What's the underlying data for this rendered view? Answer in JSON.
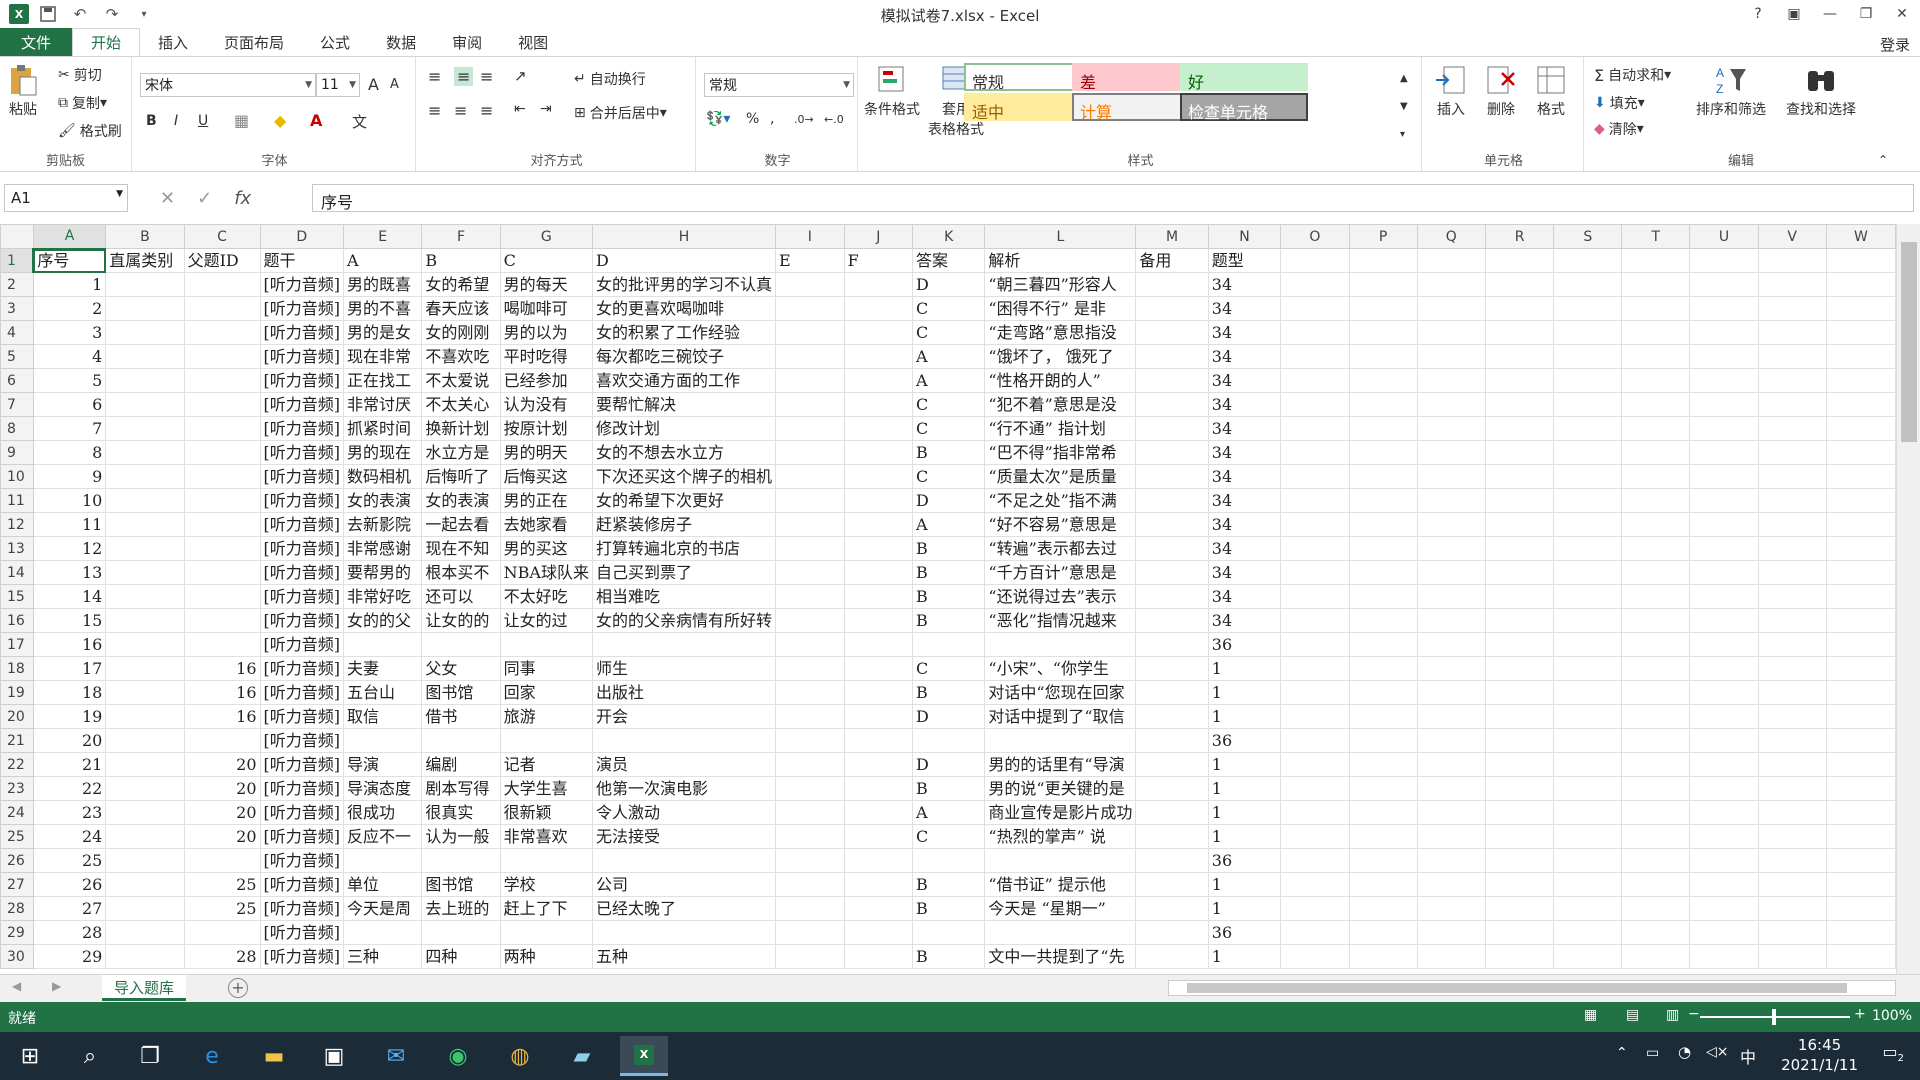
{
  "window": {
    "title": "模拟试卷7.xlsx - Excel",
    "help": "?",
    "login": "登录"
  },
  "tabs": [
    "文件",
    "开始",
    "插入",
    "页面布局",
    "公式",
    "数据",
    "审阅",
    "视图"
  ],
  "ribbon": {
    "clipboard": {
      "paste": "粘贴",
      "cut": "剪切",
      "copy": "复制",
      "format_painter": "格式刷",
      "label": "剪贴板"
    },
    "font": {
      "name": "宋体",
      "size": "11",
      "label": "字体",
      "grow": "A",
      "shrink": "A",
      "bold": "B",
      "italic": "I",
      "underline": "U"
    },
    "align": {
      "wrap": "自动换行",
      "merge": "合并后居中",
      "label": "对齐方式"
    },
    "number": {
      "format": "常规",
      "percent": "%",
      "comma": ",",
      "label": "数字"
    },
    "styles": {
      "cond": "条件格式",
      "table": "套用",
      "table2": "表格格式",
      "label": "样式",
      "cells": [
        {
          "text": "常规",
          "bg": "#ffffff",
          "fg": "#333333",
          "border": "#8cc08c"
        },
        {
          "text": "差",
          "bg": "#ffc7ce",
          "fg": "#9c0006",
          "border": "#ffc7ce"
        },
        {
          "text": "好",
          "bg": "#c6efce",
          "fg": "#006100",
          "border": "#c6efce"
        },
        {
          "text": "适中",
          "bg": "#ffeb9c",
          "fg": "#9c5700",
          "border": "#ffeb9c"
        },
        {
          "text": "计算",
          "bg": "#f2f2f2",
          "fg": "#fa7d00",
          "border": "#7f7f7f"
        },
        {
          "text": "检查单元格",
          "bg": "#a5a5a5",
          "fg": "#ffffff",
          "border": "#3f3f3f"
        }
      ]
    },
    "cells": {
      "insert": "插入",
      "delete": "删除",
      "format": "格式",
      "label": "单元格"
    },
    "edit": {
      "autosum": "自动求和",
      "fill": "填充",
      "clear": "清除",
      "sort": "排序和筛选",
      "find": "查找和选择",
      "label": "编辑"
    }
  },
  "formula_bar": {
    "name_box": "A1",
    "fx": "fx",
    "content": "序号"
  },
  "columns": [
    "A",
    "B",
    "C",
    "D",
    "E",
    "F",
    "G",
    "H",
    "I",
    "J",
    "K",
    "L",
    "M",
    "N",
    "O",
    "P",
    "Q",
    "R",
    "S",
    "T",
    "U",
    "V",
    "W"
  ],
  "rows": [
    [
      "序号",
      "直属类别",
      "父题ID",
      "题干",
      "A",
      "B",
      "C",
      "D",
      "E",
      "F",
      "答案",
      "解析",
      "备用",
      "题型"
    ],
    [
      "1",
      "",
      "",
      "[听力音频]",
      "男的既喜",
      "女的希望",
      "男的每天",
      "女的批评男的学习不认真",
      "",
      "",
      "D",
      "“朝三暮四”形容人",
      "",
      "34"
    ],
    [
      "2",
      "",
      "",
      "[听力音频]",
      "男的不喜",
      "春天应该",
      "喝咖啡可",
      "女的更喜欢喝咖啡",
      "",
      "",
      "C",
      "“困得不行” 是非",
      "",
      "34"
    ],
    [
      "3",
      "",
      "",
      "[听力音频]",
      "男的是女",
      "女的刚刚",
      "男的以为",
      "女的积累了工作经验",
      "",
      "",
      "C",
      "“走弯路”意思指没",
      "",
      "34"
    ],
    [
      "4",
      "",
      "",
      "[听力音频]",
      "现在非常",
      "不喜欢吃",
      "平时吃得",
      "每次都吃三碗饺子",
      "",
      "",
      "A",
      "“饿坏了， 饿死了",
      "",
      "34"
    ],
    [
      "5",
      "",
      "",
      "[听力音频]",
      "正在找工",
      "不太爱说",
      "已经参加",
      "喜欢交通方面的工作",
      "",
      "",
      "A",
      "“性格开朗的人”",
      "",
      "34"
    ],
    [
      "6",
      "",
      "",
      "[听力音频]",
      "非常讨厌",
      "不太关心",
      "认为没有",
      "要帮忙解决",
      "",
      "",
      "C",
      "“犯不着”意思是没",
      "",
      "34"
    ],
    [
      "7",
      "",
      "",
      "[听力音频]",
      "抓紧时间",
      "换新计划",
      "按原计划",
      "修改计划",
      "",
      "",
      "C",
      "“行不通” 指计划",
      "",
      "34"
    ],
    [
      "8",
      "",
      "",
      "[听力音频]",
      "男的现在",
      "水立方是",
      "男的明天",
      "女的不想去水立方",
      "",
      "",
      "B",
      "“巴不得”指非常希",
      "",
      "34"
    ],
    [
      "9",
      "",
      "",
      "[听力音频]",
      "数码相机",
      "后悔听了",
      "后悔买这",
      "下次还买这个牌子的相机",
      "",
      "",
      "C",
      "“质量太次”是质量",
      "",
      "34"
    ],
    [
      "10",
      "",
      "",
      "[听力音频]",
      "女的表演",
      "女的表演",
      "男的正在",
      "女的希望下次更好",
      "",
      "",
      "D",
      "“不足之处”指不满",
      "",
      "34"
    ],
    [
      "11",
      "",
      "",
      "[听力音频]",
      "去新影院",
      "一起去看",
      "去她家看",
      "赶紧装修房子",
      "",
      "",
      "A",
      "“好不容易”意思是",
      "",
      "34"
    ],
    [
      "12",
      "",
      "",
      "[听力音频]",
      "非常感谢",
      "现在不知",
      "男的买这",
      "打算转遍北京的书店",
      "",
      "",
      "B",
      "“转遍”表示都去过",
      "",
      "34"
    ],
    [
      "13",
      "",
      "",
      "[听力音频]",
      "要帮男的",
      "根本买不",
      "NBA球队来",
      "自己买到票了",
      "",
      "",
      "B",
      "“千方百计”意思是",
      "",
      "34"
    ],
    [
      "14",
      "",
      "",
      "[听力音频]",
      "非常好吃",
      "还可以",
      "不太好吃",
      "相当难吃",
      "",
      "",
      "B",
      "“还说得过去”表示",
      "",
      "34"
    ],
    [
      "15",
      "",
      "",
      "[听力音频]",
      "女的的父",
      "让女的的",
      "让女的过",
      "女的的父亲病情有所好转",
      "",
      "",
      "B",
      "“恶化”指情况越来",
      "",
      "34"
    ],
    [
      "16",
      "",
      "",
      "[听力音频]",
      "",
      "",
      "",
      "",
      "",
      "",
      "",
      "",
      "",
      "36"
    ],
    [
      "17",
      "",
      "16",
      "[听力音频]",
      "夫妻",
      "父女",
      "同事",
      "师生",
      "",
      "",
      "C",
      "“小宋”、“你学生",
      "",
      "1"
    ],
    [
      "18",
      "",
      "16",
      "[听力音频]",
      "五台山",
      "图书馆",
      "回家",
      "出版社",
      "",
      "",
      "B",
      "对话中“您现在回家",
      "",
      "1"
    ],
    [
      "19",
      "",
      "16",
      "[听力音频]",
      "取信",
      "借书",
      "旅游",
      "开会",
      "",
      "",
      "D",
      "对话中提到了“取信",
      "",
      "1"
    ],
    [
      "20",
      "",
      "",
      "[听力音频]",
      "",
      "",
      "",
      "",
      "",
      "",
      "",
      "",
      "",
      "36"
    ],
    [
      "21",
      "",
      "20",
      "[听力音频]",
      "导演",
      "编剧",
      "记者",
      "演员",
      "",
      "",
      "D",
      "男的的话里有“导演",
      "",
      "1"
    ],
    [
      "22",
      "",
      "20",
      "[听力音频]",
      "导演态度",
      "剧本写得",
      "大学生喜",
      "他第一次演电影",
      "",
      "",
      "B",
      "男的说“更关键的是",
      "",
      "1"
    ],
    [
      "23",
      "",
      "20",
      "[听力音频]",
      "很成功",
      "很真实",
      "很新颖",
      "令人激动",
      "",
      "",
      "A",
      "商业宣传是影片成功",
      "",
      "1"
    ],
    [
      "24",
      "",
      "20",
      "[听力音频]",
      "反应不一",
      "认为一般",
      "非常喜欢",
      "无法接受",
      "",
      "",
      "C",
      "“热烈的掌声” 说",
      "",
      "1"
    ],
    [
      "25",
      "",
      "",
      "[听力音频]",
      "",
      "",
      "",
      "",
      "",
      "",
      "",
      "",
      "",
      "36"
    ],
    [
      "26",
      "",
      "25",
      "[听力音频]",
      "单位",
      "图书馆",
      "学校",
      "公司",
      "",
      "",
      "B",
      "“借书证” 提示他",
      "",
      "1"
    ],
    [
      "27",
      "",
      "25",
      "[听力音频]",
      "今天是周",
      "去上班的",
      "赶上了下",
      "已经太晚了",
      "",
      "",
      "B",
      "今天是 “星期一”",
      "",
      "1"
    ],
    [
      "28",
      "",
      "",
      "[听力音频]",
      "",
      "",
      "",
      "",
      "",
      "",
      "",
      "",
      "",
      "36"
    ],
    [
      "29",
      "",
      "28",
      "[听力音频]",
      "三种",
      "四种",
      "两种",
      "五种",
      "",
      "",
      "B",
      "文中一共提到了“先",
      "",
      "1"
    ]
  ],
  "sheet_tab": "导入题库",
  "status": {
    "text": "就绪",
    "zoom": "100%"
  },
  "taskbar": {
    "time": "16:45",
    "date": "2021/1/11",
    "ime": "中",
    "notif": "2"
  }
}
